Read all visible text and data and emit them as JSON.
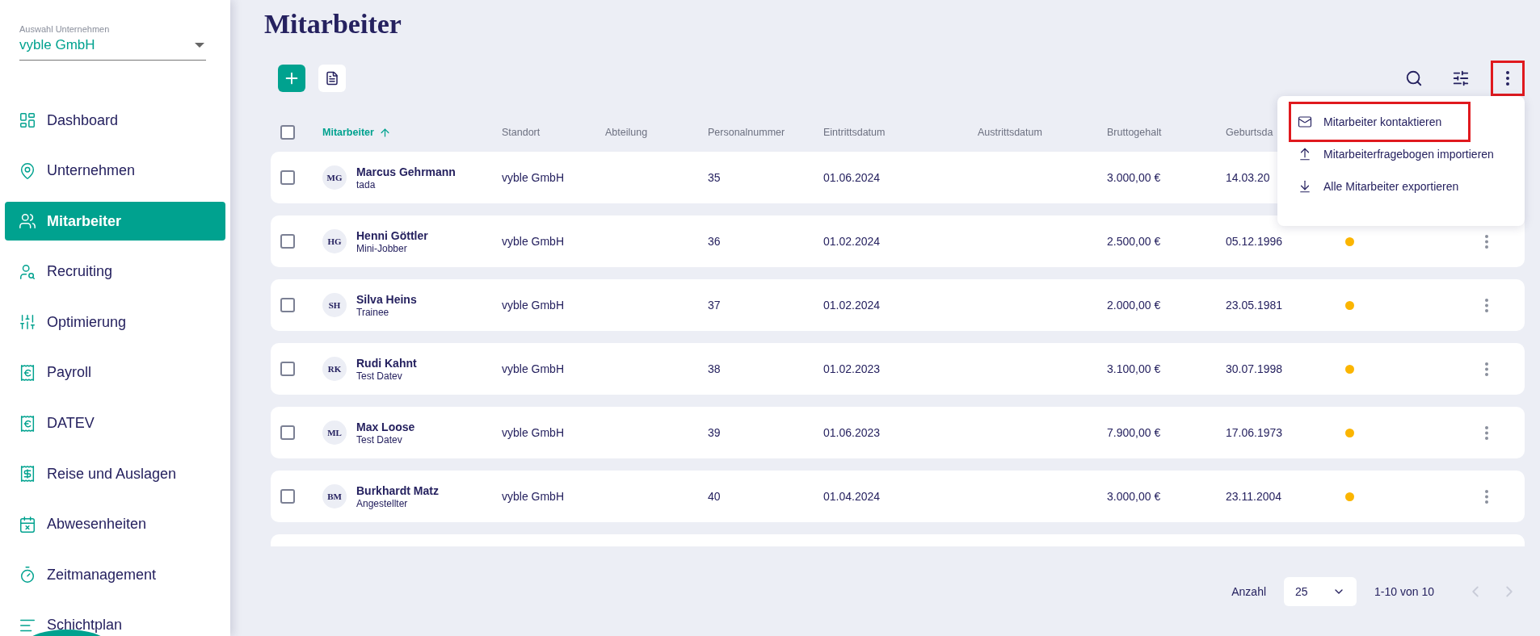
{
  "sidebar": {
    "company_select": {
      "label": "Auswahl Unternehmen",
      "value": "vyble GmbH"
    },
    "items": [
      {
        "label": "Dashboard",
        "selected": false
      },
      {
        "label": "Unternehmen",
        "selected": false
      },
      {
        "label": "Mitarbeiter",
        "selected": true
      },
      {
        "label": "Recruiting",
        "selected": false
      },
      {
        "label": "Optimierung",
        "selected": false
      },
      {
        "label": "Payroll",
        "selected": false
      },
      {
        "label": "DATEV",
        "selected": false
      },
      {
        "label": "Reise und Auslagen",
        "selected": false
      },
      {
        "label": "Abwesenheiten",
        "selected": false
      },
      {
        "label": "Zeitmanagement",
        "selected": false
      },
      {
        "label": "Schichtplan",
        "selected": false
      }
    ]
  },
  "page": {
    "title": "Mitarbeiter"
  },
  "toolbar": {
    "more_highlighted": true
  },
  "table": {
    "select_all_checked": false,
    "columns": [
      {
        "label": "Mitarbeiter",
        "sorted": true
      },
      {
        "label": "Standort",
        "sorted": false
      },
      {
        "label": "Abteilung",
        "sorted": false
      },
      {
        "label": "Personalnummer",
        "sorted": false
      },
      {
        "label": "Eintrittsdatum",
        "sorted": false
      },
      {
        "label": "Austrittsdatum",
        "sorted": false
      },
      {
        "label": "Bruttogehalt",
        "sorted": false
      },
      {
        "label": "Geburtsda",
        "sorted": false
      }
    ],
    "rows": [
      {
        "initials": "MG",
        "name": "Marcus Gehrmann",
        "role": "tada",
        "location": "vyble GmbH",
        "number": "35",
        "entry": "01.06.2024",
        "salary": "3.000,00 €",
        "birth": "14.03.20",
        "checked": false,
        "actions": false
      },
      {
        "initials": "HG",
        "name": "Henni Göttler",
        "role": "Mini-Jobber",
        "location": "vyble GmbH",
        "number": "36",
        "entry": "01.02.2024",
        "salary": "2.500,00 €",
        "birth": "05.12.1996",
        "color": "#fbb500",
        "checked": false,
        "actions": true
      },
      {
        "initials": "SH",
        "name": "Silva Heins",
        "role": "Trainee",
        "location": "vyble GmbH",
        "number": "37",
        "entry": "01.02.2024",
        "salary": "2.000,00 €",
        "birth": "23.05.1981",
        "color": "#fbb500",
        "checked": false,
        "actions": true
      },
      {
        "initials": "RK",
        "name": "Rudi Kahnt",
        "role": "Test Datev",
        "location": "vyble GmbH",
        "number": "38",
        "entry": "01.02.2023",
        "salary": "3.100,00 €",
        "birth": "30.07.1998",
        "color": "#fbb500",
        "checked": false,
        "actions": true
      },
      {
        "initials": "ML",
        "name": "Max Loose",
        "role": "Test Datev",
        "location": "vyble GmbH",
        "number": "39",
        "entry": "01.06.2023",
        "salary": "7.900,00 €",
        "birth": "17.06.1973",
        "color": "#fbb500",
        "checked": false,
        "actions": true
      },
      {
        "initials": "BM",
        "name": "Burkhardt Matz",
        "role": "Angestellter",
        "location": "vyble GmbH",
        "number": "40",
        "entry": "01.04.2024",
        "salary": "3.000,00 €",
        "birth": "23.11.2004",
        "color": "#fbb500",
        "checked": false,
        "actions": true
      }
    ]
  },
  "menu": {
    "items": [
      {
        "label": "Mitarbeiter kontaktieren",
        "highlighted": true
      },
      {
        "label": "Mitarbeiterfragebogen importieren",
        "highlighted": false
      },
      {
        "label": "Alle Mitarbeiter exportieren",
        "highlighted": false
      }
    ]
  },
  "pagination": {
    "label": "Anzahl",
    "page_size": "25",
    "range": "1-10 von 10"
  }
}
